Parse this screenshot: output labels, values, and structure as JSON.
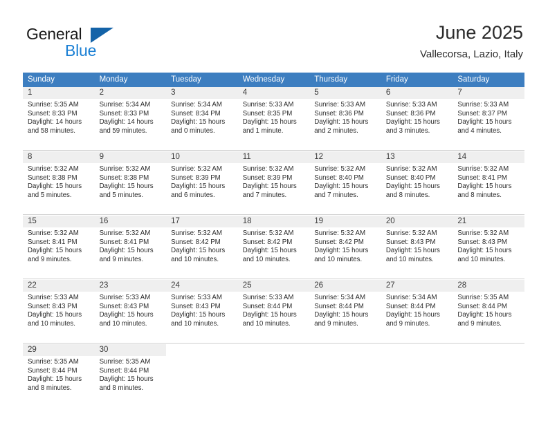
{
  "brand": {
    "line1": "General",
    "line2": "Blue",
    "triangle_icon": "triangle-icon",
    "accent_dark": "#1463a8",
    "accent_light": "#1a7fd4"
  },
  "header": {
    "title": "June 2025",
    "subtitle": "Vallecorsa, Lazio, Italy"
  },
  "calendar": {
    "header_bg": "#3d7ec0",
    "daynum_bg": "#efefef",
    "weekdays": [
      "Sunday",
      "Monday",
      "Tuesday",
      "Wednesday",
      "Thursday",
      "Friday",
      "Saturday"
    ],
    "weeks": [
      [
        {
          "day": "1",
          "sunrise": "Sunrise: 5:35 AM",
          "sunset": "Sunset: 8:33 PM",
          "daylight_line1": "Daylight: 14 hours",
          "daylight_line2": "and 58 minutes."
        },
        {
          "day": "2",
          "sunrise": "Sunrise: 5:34 AM",
          "sunset": "Sunset: 8:33 PM",
          "daylight_line1": "Daylight: 14 hours",
          "daylight_line2": "and 59 minutes."
        },
        {
          "day": "3",
          "sunrise": "Sunrise: 5:34 AM",
          "sunset": "Sunset: 8:34 PM",
          "daylight_line1": "Daylight: 15 hours",
          "daylight_line2": "and 0 minutes."
        },
        {
          "day": "4",
          "sunrise": "Sunrise: 5:33 AM",
          "sunset": "Sunset: 8:35 PM",
          "daylight_line1": "Daylight: 15 hours",
          "daylight_line2": "and 1 minute."
        },
        {
          "day": "5",
          "sunrise": "Sunrise: 5:33 AM",
          "sunset": "Sunset: 8:36 PM",
          "daylight_line1": "Daylight: 15 hours",
          "daylight_line2": "and 2 minutes."
        },
        {
          "day": "6",
          "sunrise": "Sunrise: 5:33 AM",
          "sunset": "Sunset: 8:36 PM",
          "daylight_line1": "Daylight: 15 hours",
          "daylight_line2": "and 3 minutes."
        },
        {
          "day": "7",
          "sunrise": "Sunrise: 5:33 AM",
          "sunset": "Sunset: 8:37 PM",
          "daylight_line1": "Daylight: 15 hours",
          "daylight_line2": "and 4 minutes."
        }
      ],
      [
        {
          "day": "8",
          "sunrise": "Sunrise: 5:32 AM",
          "sunset": "Sunset: 8:38 PM",
          "daylight_line1": "Daylight: 15 hours",
          "daylight_line2": "and 5 minutes."
        },
        {
          "day": "9",
          "sunrise": "Sunrise: 5:32 AM",
          "sunset": "Sunset: 8:38 PM",
          "daylight_line1": "Daylight: 15 hours",
          "daylight_line2": "and 5 minutes."
        },
        {
          "day": "10",
          "sunrise": "Sunrise: 5:32 AM",
          "sunset": "Sunset: 8:39 PM",
          "daylight_line1": "Daylight: 15 hours",
          "daylight_line2": "and 6 minutes."
        },
        {
          "day": "11",
          "sunrise": "Sunrise: 5:32 AM",
          "sunset": "Sunset: 8:39 PM",
          "daylight_line1": "Daylight: 15 hours",
          "daylight_line2": "and 7 minutes."
        },
        {
          "day": "12",
          "sunrise": "Sunrise: 5:32 AM",
          "sunset": "Sunset: 8:40 PM",
          "daylight_line1": "Daylight: 15 hours",
          "daylight_line2": "and 7 minutes."
        },
        {
          "day": "13",
          "sunrise": "Sunrise: 5:32 AM",
          "sunset": "Sunset: 8:40 PM",
          "daylight_line1": "Daylight: 15 hours",
          "daylight_line2": "and 8 minutes."
        },
        {
          "day": "14",
          "sunrise": "Sunrise: 5:32 AM",
          "sunset": "Sunset: 8:41 PM",
          "daylight_line1": "Daylight: 15 hours",
          "daylight_line2": "and 8 minutes."
        }
      ],
      [
        {
          "day": "15",
          "sunrise": "Sunrise: 5:32 AM",
          "sunset": "Sunset: 8:41 PM",
          "daylight_line1": "Daylight: 15 hours",
          "daylight_line2": "and 9 minutes."
        },
        {
          "day": "16",
          "sunrise": "Sunrise: 5:32 AM",
          "sunset": "Sunset: 8:41 PM",
          "daylight_line1": "Daylight: 15 hours",
          "daylight_line2": "and 9 minutes."
        },
        {
          "day": "17",
          "sunrise": "Sunrise: 5:32 AM",
          "sunset": "Sunset: 8:42 PM",
          "daylight_line1": "Daylight: 15 hours",
          "daylight_line2": "and 10 minutes."
        },
        {
          "day": "18",
          "sunrise": "Sunrise: 5:32 AM",
          "sunset": "Sunset: 8:42 PM",
          "daylight_line1": "Daylight: 15 hours",
          "daylight_line2": "and 10 minutes."
        },
        {
          "day": "19",
          "sunrise": "Sunrise: 5:32 AM",
          "sunset": "Sunset: 8:42 PM",
          "daylight_line1": "Daylight: 15 hours",
          "daylight_line2": "and 10 minutes."
        },
        {
          "day": "20",
          "sunrise": "Sunrise: 5:32 AM",
          "sunset": "Sunset: 8:43 PM",
          "daylight_line1": "Daylight: 15 hours",
          "daylight_line2": "and 10 minutes."
        },
        {
          "day": "21",
          "sunrise": "Sunrise: 5:32 AM",
          "sunset": "Sunset: 8:43 PM",
          "daylight_line1": "Daylight: 15 hours",
          "daylight_line2": "and 10 minutes."
        }
      ],
      [
        {
          "day": "22",
          "sunrise": "Sunrise: 5:33 AM",
          "sunset": "Sunset: 8:43 PM",
          "daylight_line1": "Daylight: 15 hours",
          "daylight_line2": "and 10 minutes."
        },
        {
          "day": "23",
          "sunrise": "Sunrise: 5:33 AM",
          "sunset": "Sunset: 8:43 PM",
          "daylight_line1": "Daylight: 15 hours",
          "daylight_line2": "and 10 minutes."
        },
        {
          "day": "24",
          "sunrise": "Sunrise: 5:33 AM",
          "sunset": "Sunset: 8:43 PM",
          "daylight_line1": "Daylight: 15 hours",
          "daylight_line2": "and 10 minutes."
        },
        {
          "day": "25",
          "sunrise": "Sunrise: 5:33 AM",
          "sunset": "Sunset: 8:44 PM",
          "daylight_line1": "Daylight: 15 hours",
          "daylight_line2": "and 10 minutes."
        },
        {
          "day": "26",
          "sunrise": "Sunrise: 5:34 AM",
          "sunset": "Sunset: 8:44 PM",
          "daylight_line1": "Daylight: 15 hours",
          "daylight_line2": "and 9 minutes."
        },
        {
          "day": "27",
          "sunrise": "Sunrise: 5:34 AM",
          "sunset": "Sunset: 8:44 PM",
          "daylight_line1": "Daylight: 15 hours",
          "daylight_line2": "and 9 minutes."
        },
        {
          "day": "28",
          "sunrise": "Sunrise: 5:35 AM",
          "sunset": "Sunset: 8:44 PM",
          "daylight_line1": "Daylight: 15 hours",
          "daylight_line2": "and 9 minutes."
        }
      ],
      [
        {
          "day": "29",
          "sunrise": "Sunrise: 5:35 AM",
          "sunset": "Sunset: 8:44 PM",
          "daylight_line1": "Daylight: 15 hours",
          "daylight_line2": "and 8 minutes."
        },
        {
          "day": "30",
          "sunrise": "Sunrise: 5:35 AM",
          "sunset": "Sunset: 8:44 PM",
          "daylight_line1": "Daylight: 15 hours",
          "daylight_line2": "and 8 minutes."
        },
        {
          "day": "",
          "sunrise": "",
          "sunset": "",
          "daylight_line1": "",
          "daylight_line2": ""
        },
        {
          "day": "",
          "sunrise": "",
          "sunset": "",
          "daylight_line1": "",
          "daylight_line2": ""
        },
        {
          "day": "",
          "sunrise": "",
          "sunset": "",
          "daylight_line1": "",
          "daylight_line2": ""
        },
        {
          "day": "",
          "sunrise": "",
          "sunset": "",
          "daylight_line1": "",
          "daylight_line2": ""
        },
        {
          "day": "",
          "sunrise": "",
          "sunset": "",
          "daylight_line1": "",
          "daylight_line2": ""
        }
      ]
    ]
  }
}
